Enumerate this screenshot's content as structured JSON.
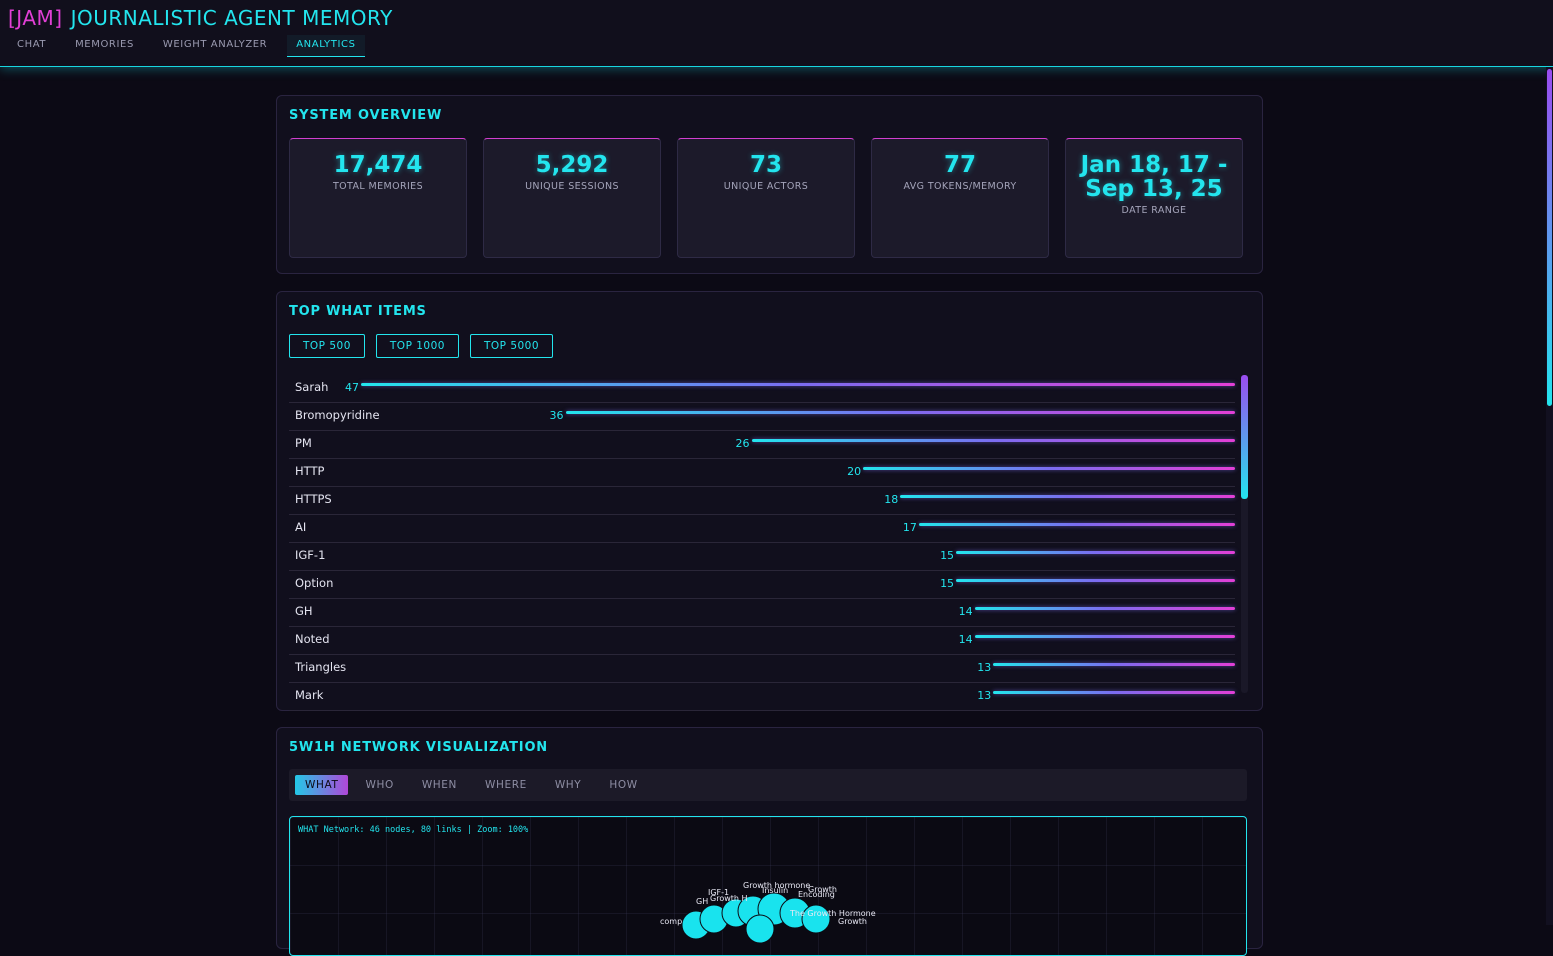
{
  "header": {
    "tag": "[JAM]",
    "title": "JOURNALISTIC AGENT MEMORY",
    "tabs": [
      {
        "label": "CHAT",
        "active": false
      },
      {
        "label": "MEMORIES",
        "active": false
      },
      {
        "label": "WEIGHT ANALYZER",
        "active": false
      },
      {
        "label": "ANALYTICS",
        "active": true
      }
    ]
  },
  "overview": {
    "title": "SYSTEM OVERVIEW",
    "stats": [
      {
        "value": "17,474",
        "label": "TOTAL MEMORIES"
      },
      {
        "value": "5,292",
        "label": "UNIQUE SESSIONS"
      },
      {
        "value": "73",
        "label": "UNIQUE ACTORS"
      },
      {
        "value": "77",
        "label": "AVG TOKENS/MEMORY"
      },
      {
        "value": "Jan 18, 17 - Sep 13, 25",
        "label": "DATE RANGE"
      }
    ]
  },
  "top_what": {
    "title": "TOP WHAT ITEMS",
    "buttons": [
      "TOP 500",
      "TOP 1000",
      "TOP 5000"
    ],
    "max": 47,
    "items": [
      {
        "label": "Sarah",
        "count": 47
      },
      {
        "label": "Bromopyridine",
        "count": 36
      },
      {
        "label": "PM",
        "count": 26
      },
      {
        "label": "HTTP",
        "count": 20
      },
      {
        "label": "HTTPS",
        "count": 18
      },
      {
        "label": "AI",
        "count": 17
      },
      {
        "label": "IGF-1",
        "count": 15
      },
      {
        "label": "Option",
        "count": 15
      },
      {
        "label": "GH",
        "count": 14
      },
      {
        "label": "Noted",
        "count": 14
      },
      {
        "label": "Triangles",
        "count": 13
      },
      {
        "label": "Mark",
        "count": 13
      }
    ]
  },
  "network": {
    "title": "5W1H NETWORK VISUALIZATION",
    "tabs": [
      {
        "label": "WHAT",
        "active": true
      },
      {
        "label": "WHO",
        "active": false
      },
      {
        "label": "WHEN",
        "active": false
      },
      {
        "label": "WHERE",
        "active": false
      },
      {
        "label": "WHY",
        "active": false
      },
      {
        "label": "HOW",
        "active": false
      }
    ],
    "info": "WHAT Network: 46 nodes, 80 links | Zoom: 100%",
    "node_labels": [
      "Growth hormone",
      "IGF-1",
      "Growth H",
      "GH",
      "Insulin",
      "Growth",
      "Encoding",
      "The Growth Hormone",
      "Growth",
      "comp"
    ]
  },
  "colors": {
    "accent": "#23e5ee",
    "magenta": "#e23fd6",
    "purple": "#7b6cf0",
    "background": "#0c0a15"
  }
}
